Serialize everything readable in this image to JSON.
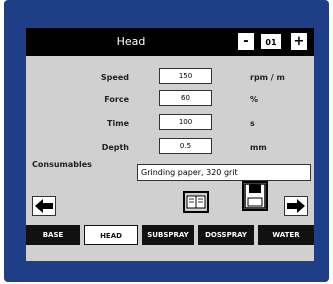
{
  "title": "Head",
  "title_buttons": {
    "minus": "-",
    "value": "01",
    "plus": "+"
  },
  "parameters": [
    {
      "label": "Speed",
      "value": "150",
      "unit": "rpm / m"
    },
    {
      "label": "Force",
      "value": "60",
      "unit": "%"
    },
    {
      "label": "Time",
      "value": "100",
      "unit": "s"
    },
    {
      "label": "Depth",
      "value": "0.5",
      "unit": "mm"
    }
  ],
  "consumables": {
    "label": "Consumables",
    "value": "Grinding paper, 320 grit"
  },
  "tabs": [
    "BASE",
    "HEAD",
    "SUBSPRAY",
    "DOSSPRAY",
    "WATER"
  ],
  "colors": {
    "frame": "#1e3f86",
    "screen": "#d0d0d0",
    "titlebar": "#000000"
  }
}
